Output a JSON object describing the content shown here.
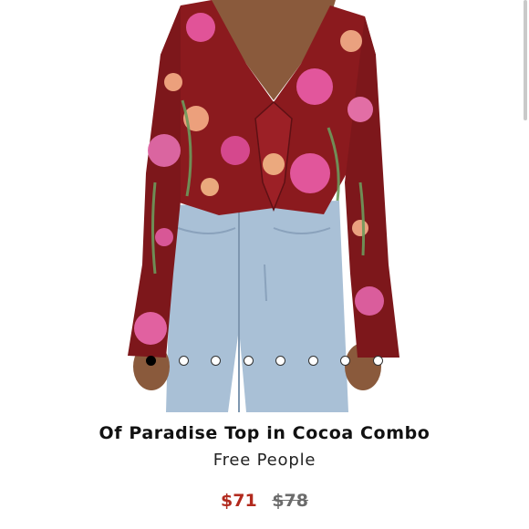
{
  "product": {
    "title": "Of Paradise Top in Cocoa Combo",
    "brand": "Free People",
    "sale_price": "$71",
    "original_price": "$78"
  },
  "gallery": {
    "image_count": 8,
    "active_index": 0
  },
  "colors": {
    "sale_price": "#b22a1e",
    "original_price": "#6b6b6b",
    "top_base": "#8b1a1e",
    "denim": "#a9c0d6"
  }
}
